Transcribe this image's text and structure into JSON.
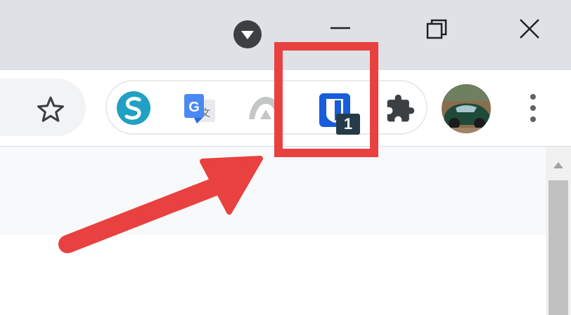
{
  "window": {
    "controls": [
      "tab-search",
      "minimize",
      "restore",
      "close"
    ]
  },
  "toolbar": {
    "icons": [
      "bookmark-star-icon",
      "simplenote-extension-icon",
      "google-translate-extension-icon",
      "grey-extension-icon",
      "bitwarden-extension-icon",
      "extensions-puzzle-icon",
      "profile-avatar",
      "chrome-menu-icon"
    ],
    "badge_count": "1"
  },
  "colors": {
    "titlebar": "#dee1e6",
    "highlight": "#e8413f",
    "bitwarden": "#175ddc",
    "badge": "#263a48"
  }
}
